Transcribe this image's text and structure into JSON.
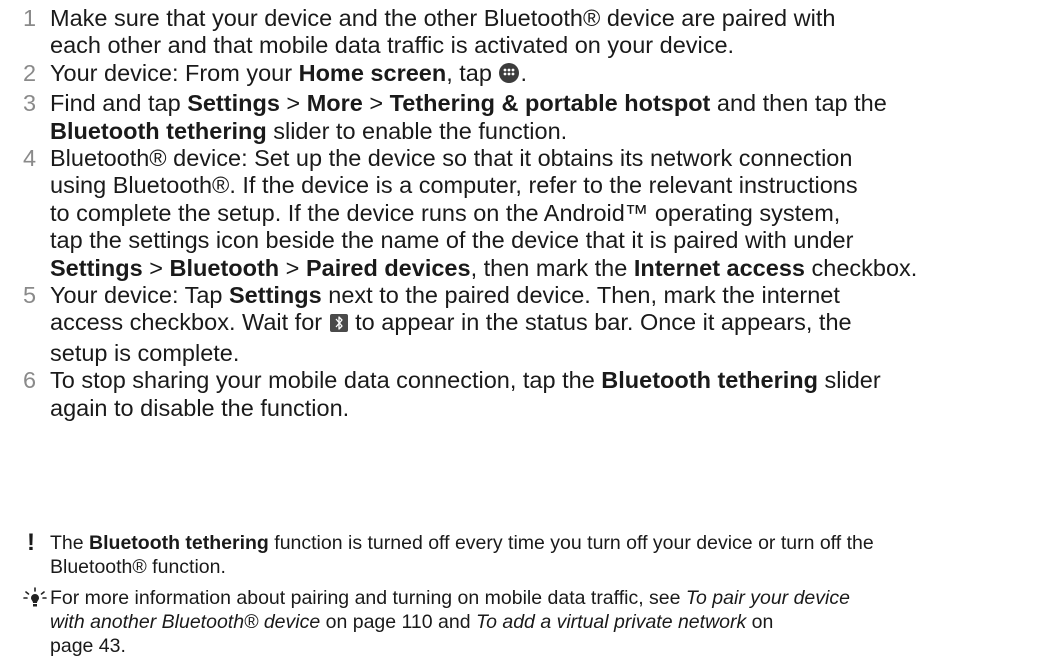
{
  "steps": [
    {
      "num": "1",
      "line1": "Make sure that your device and the other Bluetooth® device are paired with",
      "line2": "each other and that mobile data traffic is activated on your device."
    },
    {
      "num": "2",
      "a": "Your device: From your ",
      "b_home": "Home screen",
      "c": ", tap ",
      "d": ".",
      "icon": "apps-grid-icon"
    },
    {
      "num": "3",
      "a": "Find and tap ",
      "b_settings": "Settings",
      "sep1": " > ",
      "b_more": "More",
      "sep2": " > ",
      "b_tether": "Tethering & portable hotspot",
      "c": " and then tap the",
      "b_bt_tether": "Bluetooth tethering",
      "d": " slider to enable the function."
    },
    {
      "num": "4",
      "line1": "Bluetooth® device: Set up the device so that it obtains its network connection",
      "line2": "using Bluetooth®. If the device is a computer, refer to the relevant instructions",
      "line3": "to complete the setup. If the device runs on the Android™ operating system,",
      "line4": "tap the settings icon beside the name of the device that it is paired with under",
      "b_settings": "Settings",
      "sep1": " > ",
      "b_bluetooth": "Bluetooth",
      "sep2": " > ",
      "b_paired": "Paired devices",
      "e": ", then mark the ",
      "b_internet": "Internet access",
      "f": " checkbox."
    },
    {
      "num": "5",
      "a": "Your device: Tap ",
      "b_settings": "Settings",
      "c": " next to the paired device. Then, mark the internet",
      "d": "access checkbox. Wait for ",
      "e": " to appear in the status bar. Once it appears, the",
      "f": "setup is complete.",
      "icon": "bluetooth-status-icon"
    },
    {
      "num": "6",
      "a": "To stop sharing your mobile data connection, tap the ",
      "b_bt_tether": "Bluetooth tethering",
      "c": " slider",
      "d": "again to disable the function."
    }
  ],
  "warning": {
    "mark": "!",
    "a": "The ",
    "b": "Bluetooth tethering",
    "c": " function is turned off every time you turn off your device or turn off the",
    "d": "Bluetooth® function."
  },
  "tip": {
    "icon": "lightbulb-tip-icon",
    "a": "For more information about pairing and turning on mobile data traffic, see ",
    "i1": "To pair your device",
    "i1b": "with another Bluetooth® device",
    "b": " on page 110 and ",
    "i2": "To add a virtual private network",
    "c": " on",
    "d": "page 43."
  },
  "colors": {
    "text": "#1a1a1a",
    "step_number": "#8a8a8a",
    "icon_bg": "#3c3c3c"
  }
}
